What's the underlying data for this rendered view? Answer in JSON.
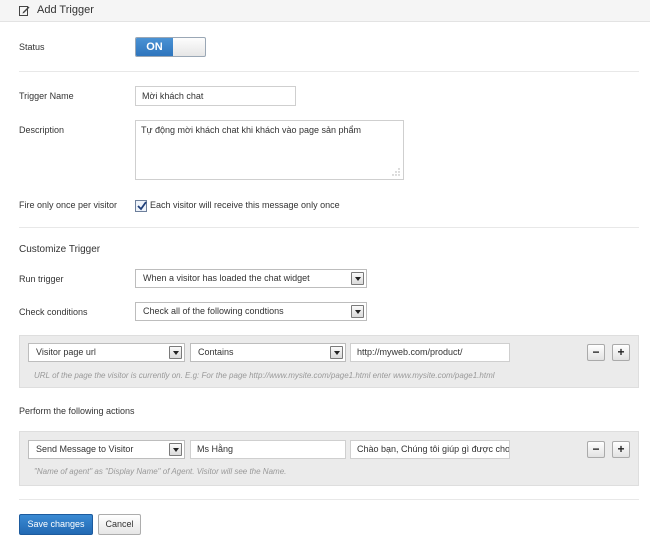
{
  "header": {
    "title": "Add Trigger",
    "icon": "edit-icon"
  },
  "status": {
    "label": "Status",
    "toggle_value": "ON"
  },
  "trigger_name": {
    "label": "Trigger Name",
    "value": "Mời khách chat"
  },
  "description": {
    "label": "Description",
    "value": "Tự động mời khách chat khi khách vào page sản phẩm"
  },
  "fire_once": {
    "label": "Fire only once per visitor",
    "checked": true,
    "checkbox_label": "Each visitor will receive this message only once"
  },
  "customize": {
    "heading": "Customize Trigger",
    "run_trigger": {
      "label": "Run trigger",
      "selected": "When a visitor has loaded the chat widget"
    },
    "check_conditions": {
      "label": "Check conditions",
      "selected": "Check all of the following condtions"
    }
  },
  "condition_row": {
    "field": "Visitor page url",
    "operator": "Contains",
    "value": "http://myweb.com/product/",
    "hint": "URL of the page the visitor is currently on. E.g: For the page http://www.mysite.com/page1.html enter www.mysite.com/page1.html",
    "remove_label": "−",
    "add_label": "+"
  },
  "actions": {
    "heading": "Perform the following actions",
    "action": "Send Message to Visitor",
    "agent_name": "Ms Hằng",
    "message": "Chào bạn, Chúng tôi giúp gì được cho",
    "hint": "\"Name of agent\" as \"Display Name\" of Agent. Visitor will see the Name.",
    "remove_label": "−",
    "add_label": "+"
  },
  "footer": {
    "save_label": "Save changes",
    "cancel_label": "Cancel"
  },
  "colors": {
    "primary": "#2a78c3",
    "panel": "#ebebeb",
    "hint": "#999999"
  }
}
